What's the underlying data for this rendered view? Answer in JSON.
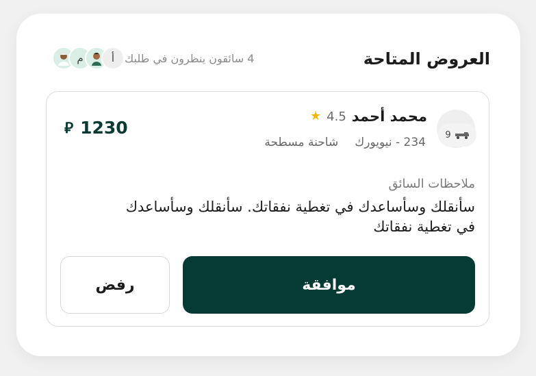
{
  "header": {
    "title": "العروض المتاحة",
    "waiting_text": "4 سائقون ينظرون في طلبك",
    "avatars": [
      {
        "type": "photo",
        "icon": "driver-photo-icon"
      },
      {
        "type": "letter",
        "letter": "م"
      },
      {
        "type": "photo",
        "icon": "driver-photo-icon"
      },
      {
        "type": "letter",
        "letter": "أ"
      }
    ]
  },
  "offer": {
    "driver_name": "محمد أحمد",
    "rating": "4.5",
    "vehicle_count": "9",
    "vehicle_icon": "truck-icon",
    "plate": "234 - نيويورك",
    "vehicle_type": "شاحنة مسطحة",
    "price": "1230",
    "currency_icon": "riyal-icon",
    "notes_label": "ملاحظات السائق",
    "notes_text": "سأنقلك وسأساعدك في تغطية نفقاتك. سأنقلك وسأساعدك في تغطية نفقاتك",
    "accept_label": "موافقة",
    "reject_label": "رفض"
  },
  "colors": {
    "primary": "#053b34",
    "star": "#f2b600",
    "avatar_bg": "#d9efe5"
  }
}
